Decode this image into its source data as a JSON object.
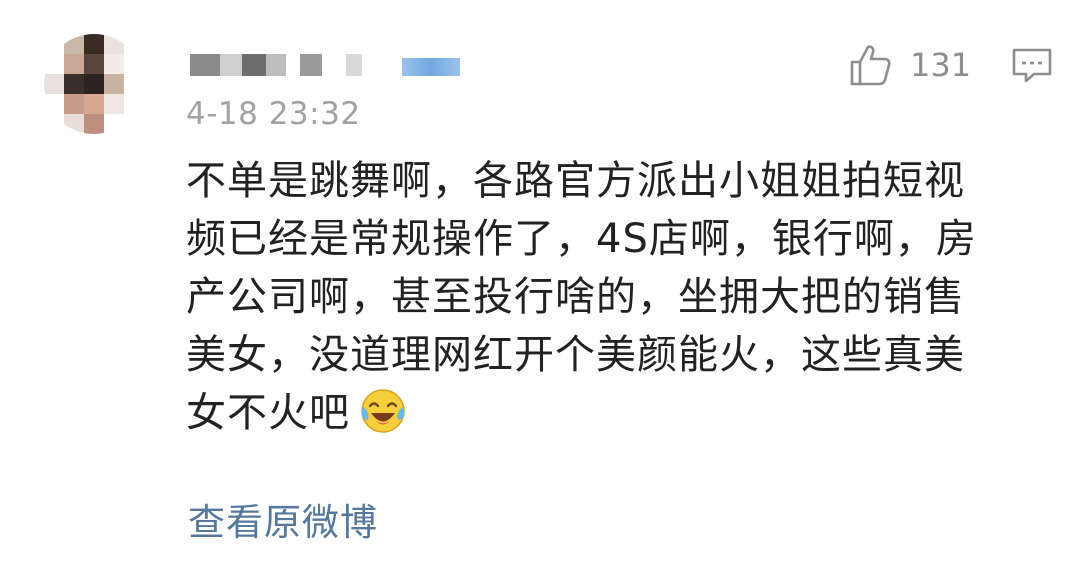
{
  "comment": {
    "author": {
      "avatar_pixel_colors": [
        "#ffffff",
        "#c9b7ab",
        "#3a2b24",
        "#e9e3df",
        "#ffffff",
        "#ffffff",
        "#caa897",
        "#5a463e",
        "#f1ece8",
        "#ffffff",
        "#e7e2df",
        "#3a2f2b",
        "#2c2220",
        "#cbb3a4",
        "#ffffff",
        "#ffffff",
        "#c79c8a",
        "#d8a890",
        "#f1e7e2",
        "#ffffff",
        "#ffffff",
        "#e9ddd7",
        "#bd8f7e",
        "#ffffff",
        "#ffffff"
      ],
      "username_blocks": [
        "#8a8a8a",
        "#cfcfcf",
        "#6d6d6d",
        "#bdbdbd",
        "#ffffff",
        "#9a9a9a",
        "#ffffff",
        "#d9d9d9"
      ]
    },
    "timestamp": "4-18 23:32",
    "like_count": "131",
    "text_lines": [
      "不单是跳舞啊，各路官方派出小姐姐拍短视",
      "频已经是常规操作了，4S店啊，银行啊，房",
      "产公司啊，甚至投行啥的，坐拥大把的销售",
      "美女，没道理网红开个美颜能火，这些真美",
      "女不火吧"
    ],
    "emoji": "laughing-crying-emoji",
    "view_original_label": "查看原微博"
  },
  "colors": {
    "text": "#222222",
    "meta": "#a2a2a2",
    "link": "#56789d",
    "icon": "#8e8e8e"
  },
  "icons": {
    "like": "thumbs-up-icon",
    "comment": "comment-bubble-icon"
  }
}
